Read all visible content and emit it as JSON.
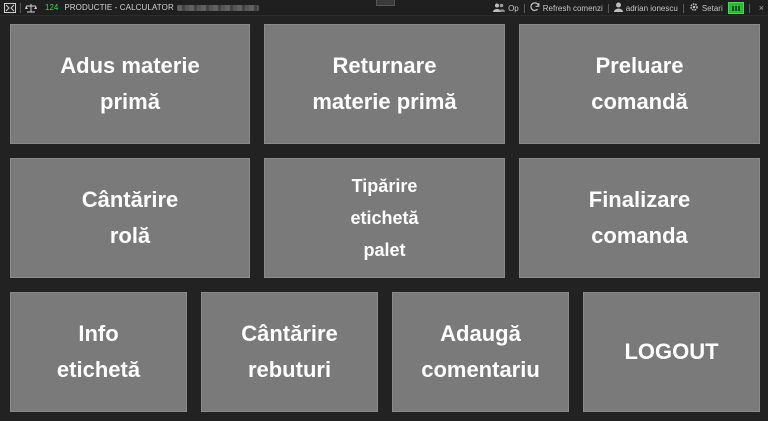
{
  "topbar": {
    "counter": "124",
    "title": "PRODUCTIE - CALCULATOR",
    "op_label": "Op",
    "refresh_label": "Refresh comenzi",
    "user_name": "adrian ionescu",
    "settings_label": "Setari",
    "close_glyph": "×",
    "accent_green": "#3fd45a"
  },
  "tiles": {
    "adus": [
      "Adus materie",
      "primă"
    ],
    "returnare": [
      "Returnare",
      "materie primă"
    ],
    "preluare": [
      "Preluare",
      "comandă"
    ],
    "cantarire_rola": [
      "Cântărire",
      "rolă"
    ],
    "tiparire": [
      "Tipărire",
      "etichetă",
      "palet"
    ],
    "finalizare": [
      "Finalizare",
      "comanda"
    ],
    "info": [
      "Info",
      "etichetă"
    ],
    "rebuturi": [
      "Cântărire",
      "rebuturi"
    ],
    "comentariu": [
      "Adaugă",
      "comentariu"
    ],
    "logout": [
      "LOGOUT"
    ]
  },
  "colors": {
    "background": "#222222",
    "tile": "#7a7a7a",
    "tile_text": "#ffffff"
  }
}
